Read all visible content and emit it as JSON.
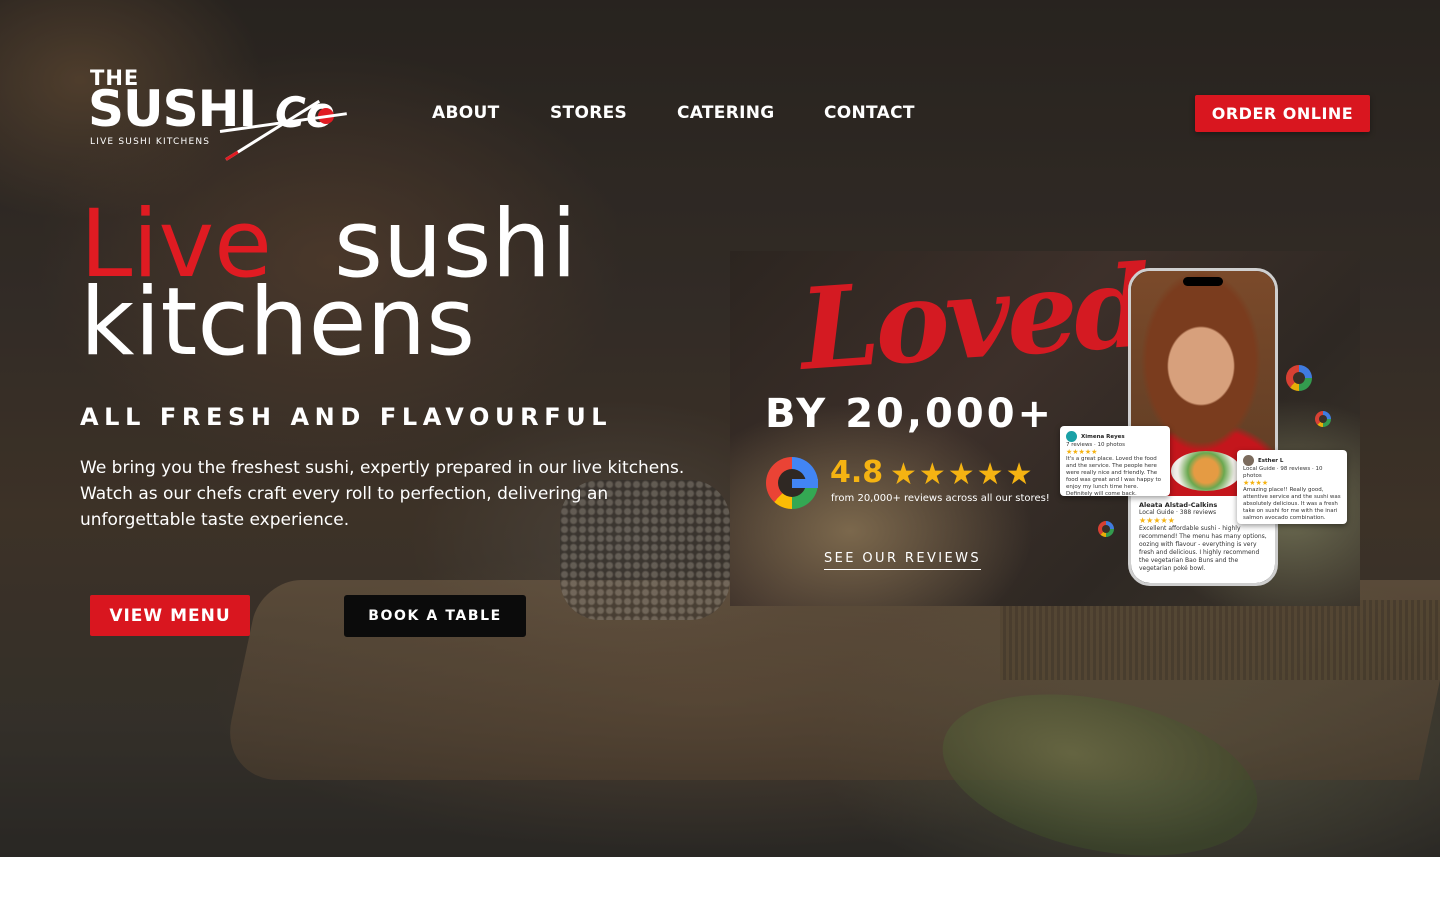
{
  "brand": {
    "the": "THE",
    "name": "SUSHI",
    "co": "Co",
    "tagline_red": "LIVE",
    "tagline_rest": " SUSHI KITCHENS"
  },
  "nav": {
    "items": [
      "ABOUT",
      "STORES",
      "CATERING",
      "CONTACT"
    ],
    "order_label": "ORDER ONLINE"
  },
  "hero": {
    "headline_red": "Live",
    "headline_white": "sushi",
    "headline_line2": "kitchens",
    "subheading": "ALL FRESH AND FLAVOURFUL",
    "description": "We bring you the freshest sushi, expertly prepared in our live kitchens. Watch as our chefs craft every roll to perfection, delivering an unforgettable taste experience.",
    "view_menu_label": "VIEW MENU",
    "book_table_label": "BOOK A TABLE"
  },
  "review_banner": {
    "loved": "Loved",
    "by_line": "BY 20,000+",
    "rating": "4.8",
    "stars": "★★★★★",
    "from_text": "from 20,000+ reviews across all our stores!",
    "see_reviews": "SEE OUR REVIEWS",
    "cards": [
      {
        "initial": "X",
        "name": "Ximena Reyes",
        "meta": "7 reviews · 10 photos",
        "stars": "★★★★★",
        "text": "It's a great place. Loved the food and the service. The people here were really nice and friendly. The food was great and I was happy to enjoy my lunch time here. Definitely will come back."
      },
      {
        "initial": "E",
        "name": "Esther L",
        "meta": "Local Guide · 98 reviews · 10 photos",
        "stars": "★★★★",
        "text": "Amazing place!! Really good, attentive service and the sushi was absolutely delicious. It was a fresh take on sushi for me with the inari salmon avocado combination."
      }
    ],
    "phone_review": {
      "name": "Aleata Alstad-Calkins",
      "meta": "Local Guide · 388 reviews",
      "stars": "★★★★★",
      "text": "Excellent affordable sushi - highly recommend! The menu has many options, oozing with flavour - everything is very fresh and delicious. I highly recommend the vegetarian Bao Buns and the vegetarian poké bowl."
    }
  },
  "colors": {
    "brand_red": "#d9161f",
    "star_gold": "#f5b312",
    "book_button": "#0b0b0b"
  }
}
